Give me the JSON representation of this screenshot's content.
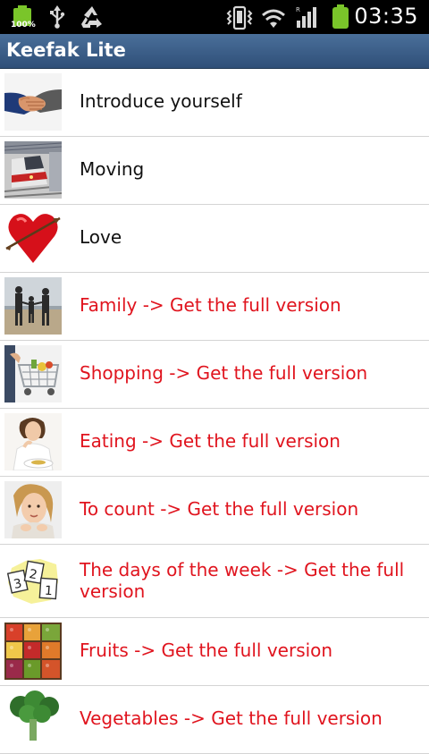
{
  "status_bar": {
    "battery_small_pct": "100%",
    "time": "03:35"
  },
  "app": {
    "title": "Keefak Lite"
  },
  "items": [
    {
      "label": "Introduce yourself",
      "locked": false,
      "image": "handshake"
    },
    {
      "label": "Moving",
      "locked": false,
      "image": "train"
    },
    {
      "label": "Love",
      "locked": false,
      "image": "heart"
    },
    {
      "label": "Family  -> Get the full version",
      "locked": true,
      "image": "family"
    },
    {
      "label": "Shopping  -> Get the full version",
      "locked": true,
      "image": "shopping-cart"
    },
    {
      "label": "Eating  -> Get the full version",
      "locked": true,
      "image": "eating"
    },
    {
      "label": "To count  -> Get the full version",
      "locked": true,
      "image": "child-counting"
    },
    {
      "label": "The days of the week  -> Get the full version",
      "locked": true,
      "image": "calendar"
    },
    {
      "label": "Fruits  -> Get the full version",
      "locked": true,
      "image": "fruit-stand"
    },
    {
      "label": "Vegetables  -> Get the full version",
      "locked": true,
      "image": "vegetables"
    }
  ],
  "colors": {
    "title_bar": "#2f4f78",
    "locked_text": "#e0141e",
    "normal_text": "#111111",
    "divider": "#d4d4d4"
  }
}
